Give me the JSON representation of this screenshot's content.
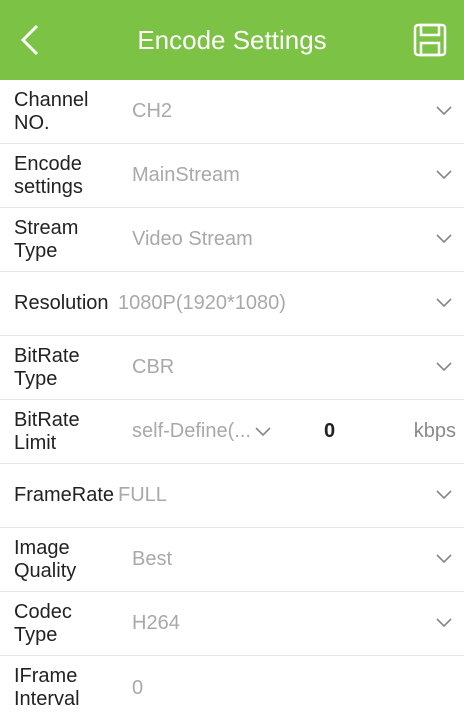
{
  "header": {
    "title": "Encode Settings"
  },
  "colors": {
    "header_bg": "#7cc244",
    "label": "#222222",
    "value": "#a9a9a9"
  },
  "settings": {
    "channel_no": {
      "label": "Channel NO.",
      "value": "CH2"
    },
    "encode_settings": {
      "label": "Encode settings",
      "value": "MainStream"
    },
    "stream_type": {
      "label": "Stream Type",
      "value": "Video Stream"
    },
    "resolution": {
      "label": "Resolution",
      "value": "1080P(1920*1080)"
    },
    "bitrate_type": {
      "label": "BitRate Type",
      "value": "CBR"
    },
    "bitrate_limit": {
      "label": "BitRate Limit",
      "value": "self-Define(...",
      "number": "0",
      "unit": "kbps"
    },
    "framerate": {
      "label": "FrameRate",
      "value": "FULL"
    },
    "image_quality": {
      "label": "Image Quality",
      "value": "Best"
    },
    "codec_type": {
      "label": "Codec Type",
      "value": "H264"
    },
    "iframe_interval": {
      "label": "IFrame Interval",
      "value": "0"
    }
  }
}
